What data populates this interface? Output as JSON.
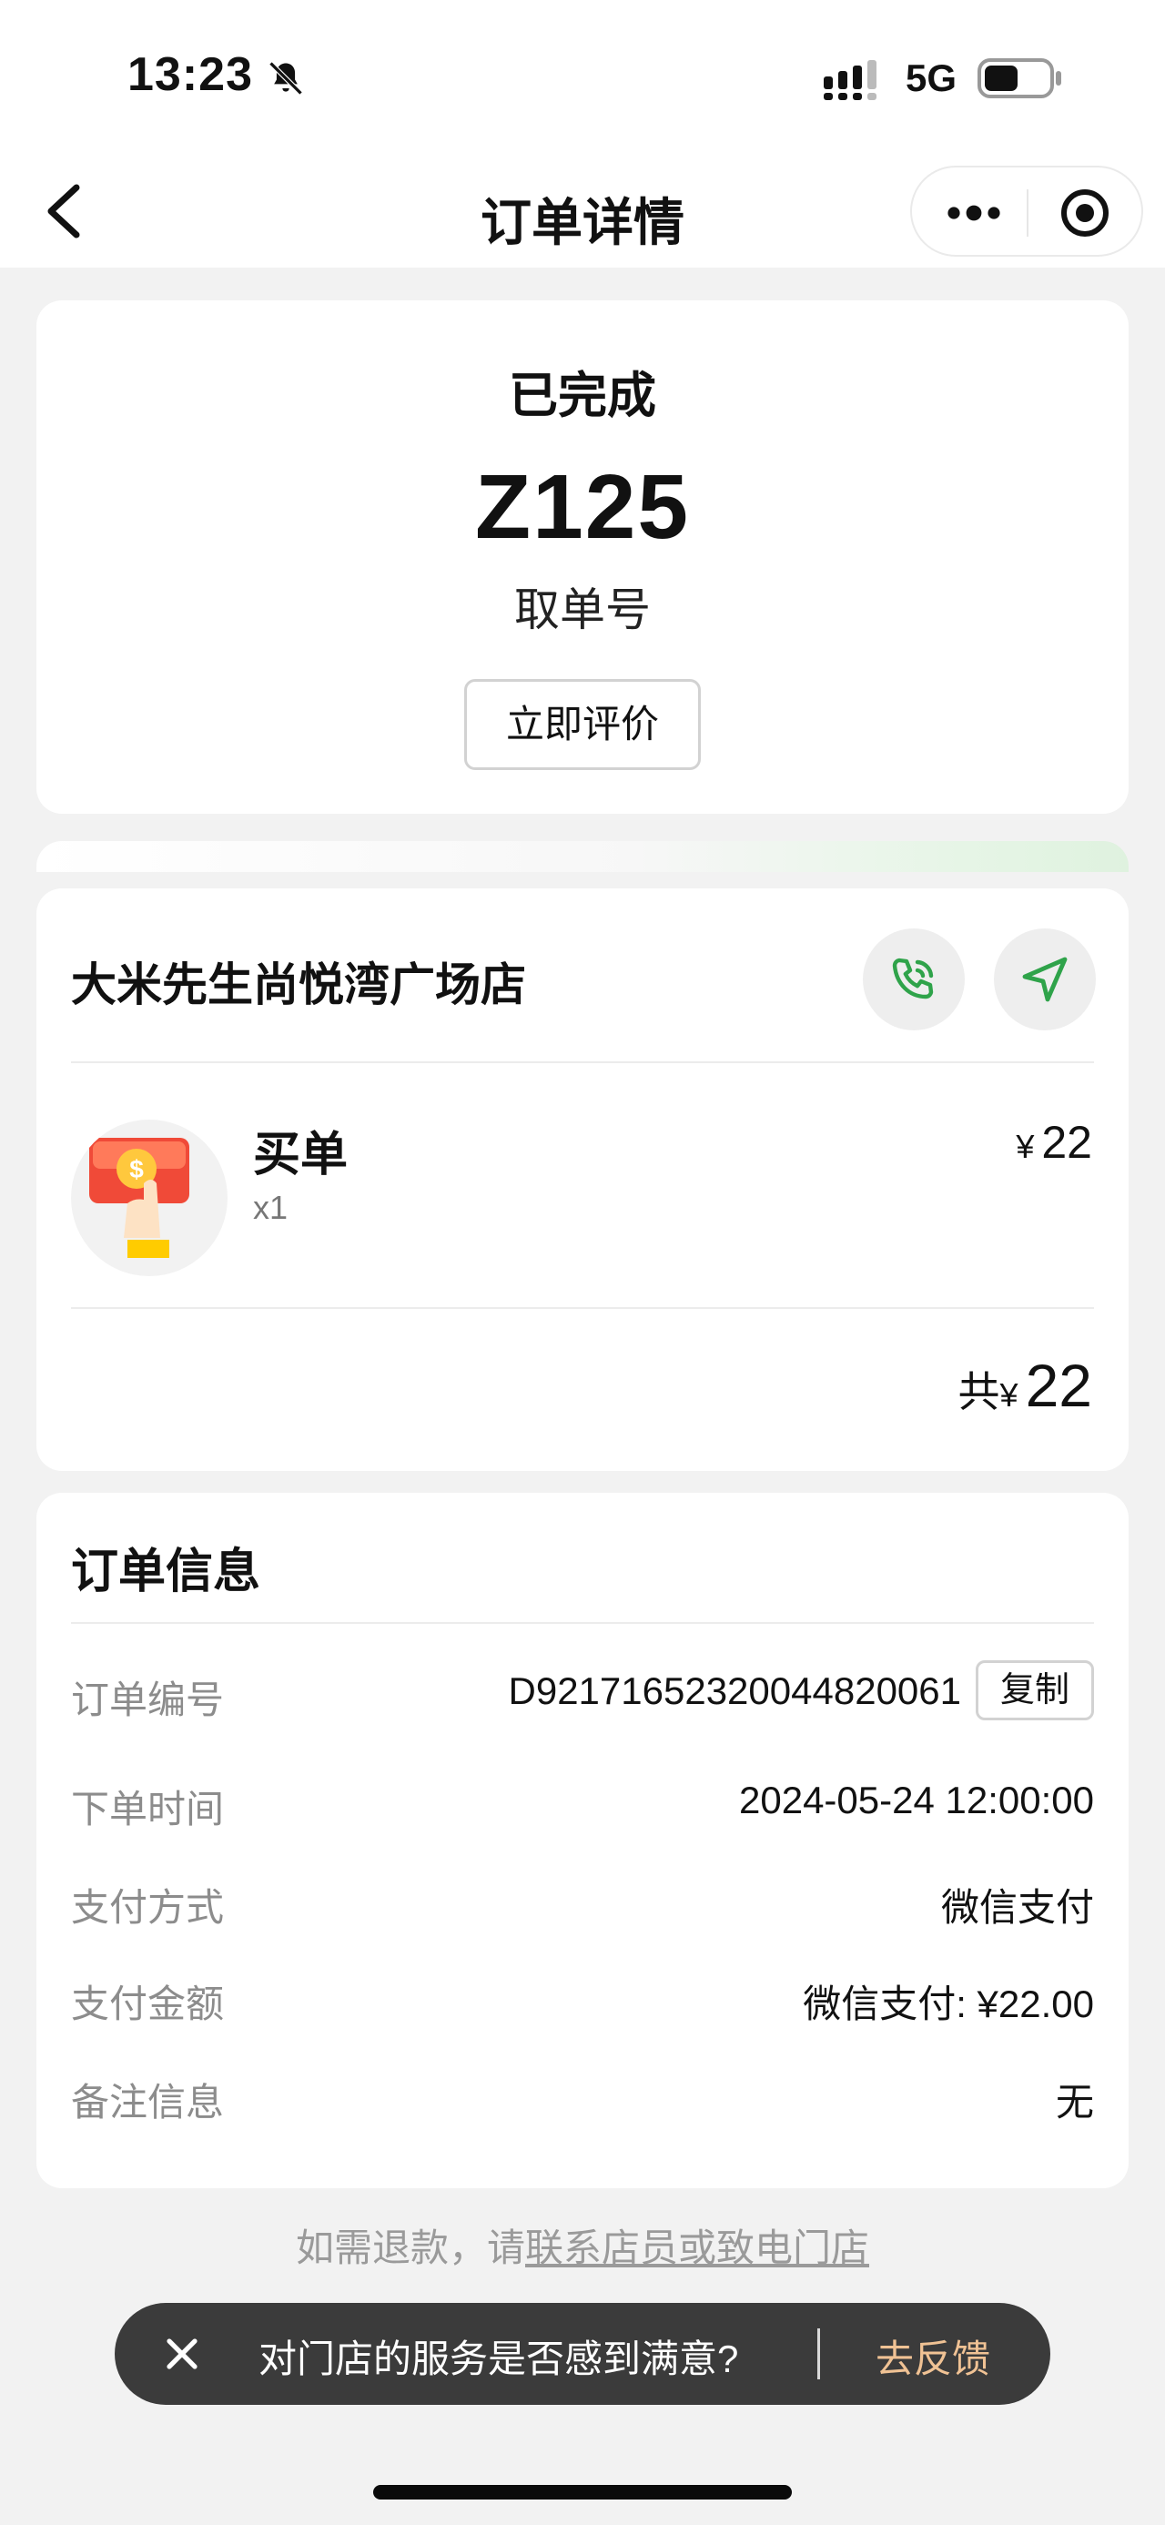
{
  "status_bar": {
    "time": "13:23",
    "network": "5G"
  },
  "nav": {
    "title": "订单详情"
  },
  "order_status": {
    "status": "已完成",
    "pickup_number": "Z125",
    "pickup_label": "取单号",
    "review_button": "立即评价"
  },
  "store": {
    "name": "大米先生尚悦湾广场店",
    "item": {
      "name": "买单",
      "qty": "x1",
      "currency": "¥",
      "price": "22"
    },
    "total": {
      "prefix": "共",
      "currency": "¥",
      "amount": "22"
    }
  },
  "order_info": {
    "title": "订单信息",
    "copy_button": "复制",
    "rows": [
      {
        "label": "订单编号",
        "value": "D92171652320044820061"
      },
      {
        "label": "下单时间",
        "value": "2024-05-24 12:00:00"
      },
      {
        "label": "支付方式",
        "value": "微信支付"
      },
      {
        "label": "支付金额",
        "value": "微信支付: ¥22.00"
      },
      {
        "label": "备注信息",
        "value": "无"
      }
    ]
  },
  "refund_note": {
    "text": "如需退款，请",
    "link": "联系店员或致电门店"
  },
  "feedback_toast": {
    "message": "对门店的服务是否感到满意?",
    "action": "去反馈"
  },
  "colors": {
    "accent_green": "#2fa34a",
    "feedback_orange": "#f0c294",
    "toast_bg": "#3b3b3b"
  }
}
